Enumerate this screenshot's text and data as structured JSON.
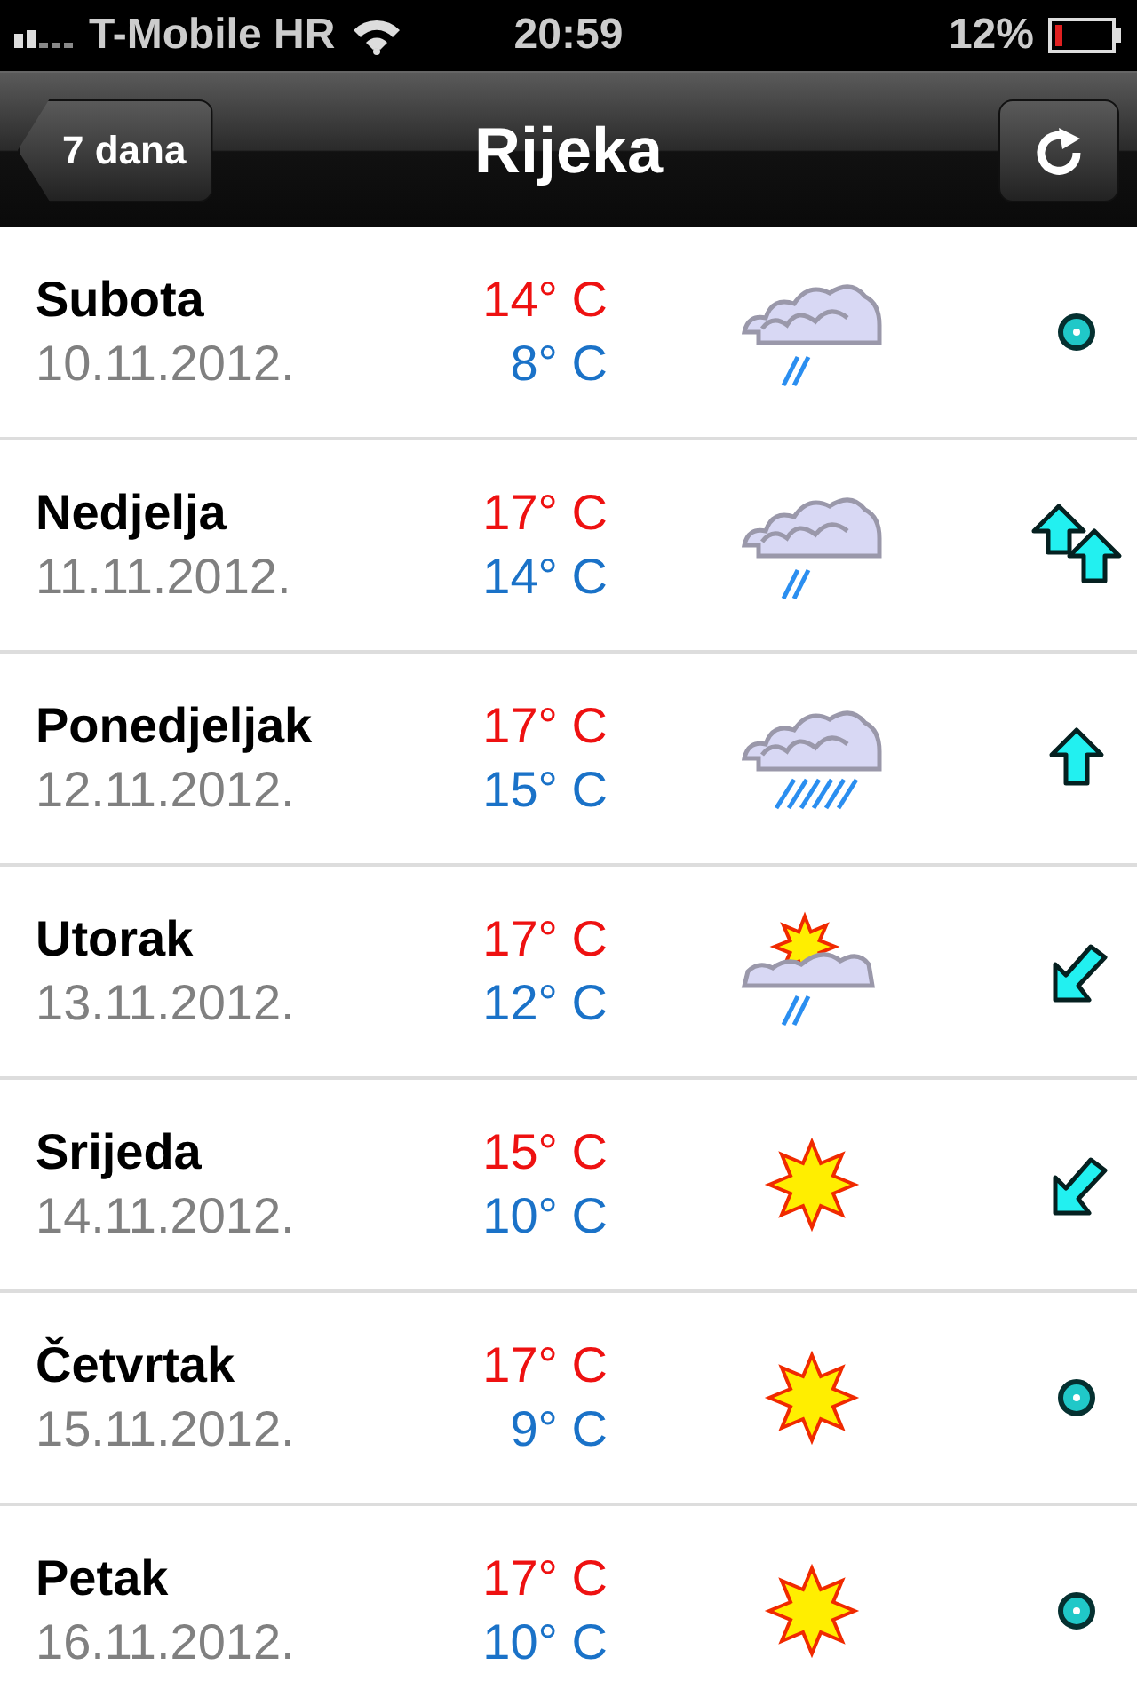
{
  "status_bar": {
    "carrier": "T-Mobile HR",
    "time": "20:59",
    "battery": "12%"
  },
  "nav_bar": {
    "back": "7 dana",
    "title": "Rijeka"
  },
  "days": [
    {
      "day": "Subota",
      "date": "10.11.2012.",
      "high": "14° C",
      "low": "8° C",
      "weather": {
        "kind": "cloud-rain"
      },
      "wind": {
        "kind": "calm"
      }
    },
    {
      "day": "Nedjelja",
      "date": "11.11.2012.",
      "high": "17° C",
      "low": "14° C",
      "weather": {
        "kind": "cloud-rain"
      },
      "wind": {
        "kind": "up-double"
      }
    },
    {
      "day": "Ponedjeljak",
      "date": "12.11.2012.",
      "high": "17° C",
      "low": "15° C",
      "weather": {
        "kind": "cloud-heavy-rain"
      },
      "wind": {
        "kind": "up"
      }
    },
    {
      "day": "Utorak",
      "date": "13.11.2012.",
      "high": "17° C",
      "low": "12° C",
      "weather": {
        "kind": "sun-cloud-rain"
      },
      "wind": {
        "kind": "down-left"
      }
    },
    {
      "day": "Srijeda",
      "date": "14.11.2012.",
      "high": "15° C",
      "low": "10° C",
      "weather": {
        "kind": "sun"
      },
      "wind": {
        "kind": "down-left"
      }
    },
    {
      "day": "Četvrtak",
      "date": "15.11.2012.",
      "high": "17° C",
      "low": "9° C",
      "weather": {
        "kind": "sun"
      },
      "wind": {
        "kind": "calm"
      }
    },
    {
      "day": "Petak",
      "date": "16.11.2012.",
      "high": "17° C",
      "low": "10° C",
      "weather": {
        "kind": "sun"
      },
      "wind": {
        "kind": "calm"
      }
    }
  ]
}
